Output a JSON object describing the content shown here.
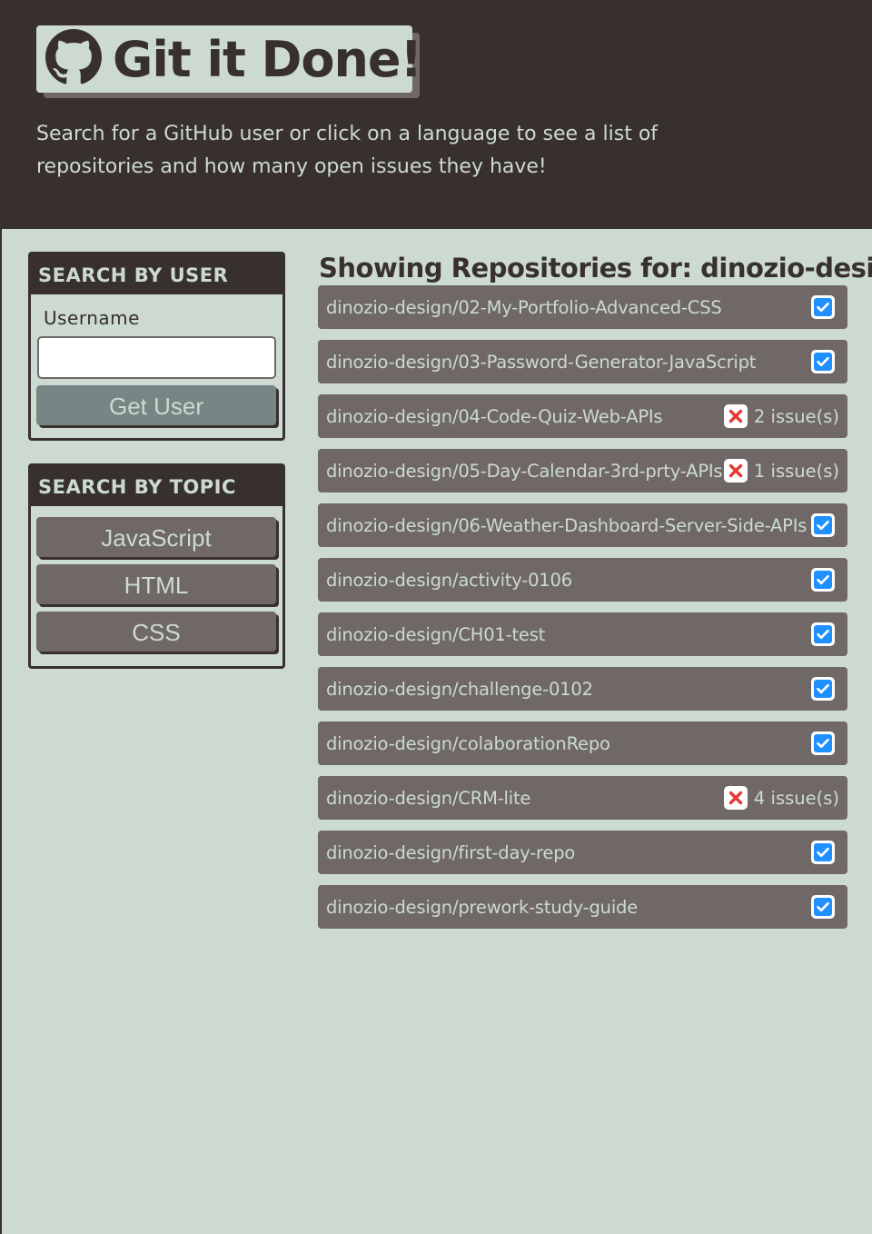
{
  "header": {
    "title": "Git it Done!",
    "subtitle": "Search for a GitHub user or click on a language to see a list of repositories and how many open issues they have!"
  },
  "search_user": {
    "heading": "SEARCH BY USER",
    "label": "Username",
    "input_value": "",
    "button_label": "Get User"
  },
  "search_topic": {
    "heading": "SEARCH BY TOPIC",
    "buttons": [
      "JavaScript",
      "HTML",
      "CSS"
    ]
  },
  "repos": {
    "title": "Showing Repositories for: dinozio-design",
    "items": [
      {
        "name": "dinozio-design/02-My-Portfolio-Advanced-CSS",
        "status": "ok",
        "issues": ""
      },
      {
        "name": "dinozio-design/03-Password-Generator-JavaScript",
        "status": "ok",
        "issues": ""
      },
      {
        "name": "dinozio-design/04-Code-Quiz-Web-APIs",
        "status": "issues",
        "issues": "2 issue(s)"
      },
      {
        "name": "dinozio-design/05-Day-Calendar-3rd-prty-APIs",
        "status": "issues",
        "issues": "1 issue(s)"
      },
      {
        "name": "dinozio-design/06-Weather-Dashboard-Server-Side-APIs",
        "status": "ok",
        "issues": ""
      },
      {
        "name": "dinozio-design/activity-0106",
        "status": "ok",
        "issues": ""
      },
      {
        "name": "dinozio-design/CH01-test",
        "status": "ok",
        "issues": ""
      },
      {
        "name": "dinozio-design/challenge-0102",
        "status": "ok",
        "issues": ""
      },
      {
        "name": "dinozio-design/colaborationRepo",
        "status": "ok",
        "issues": ""
      },
      {
        "name": "dinozio-design/CRM-lite",
        "status": "issues",
        "issues": "4 issue(s)"
      },
      {
        "name": "dinozio-design/first-day-repo",
        "status": "ok",
        "issues": ""
      },
      {
        "name": "dinozio-design/prework-study-guide",
        "status": "ok",
        "issues": ""
      }
    ]
  },
  "colors": {
    "dark": "#38302e",
    "light": "#ccdad1",
    "item_bg": "#6f6866",
    "check_blue": "#1e90ff",
    "error_red": "#e53935"
  },
  "icons": {
    "logo": "github-octocat-icon",
    "ok": "check-box-icon",
    "issues": "cross-box-icon"
  }
}
